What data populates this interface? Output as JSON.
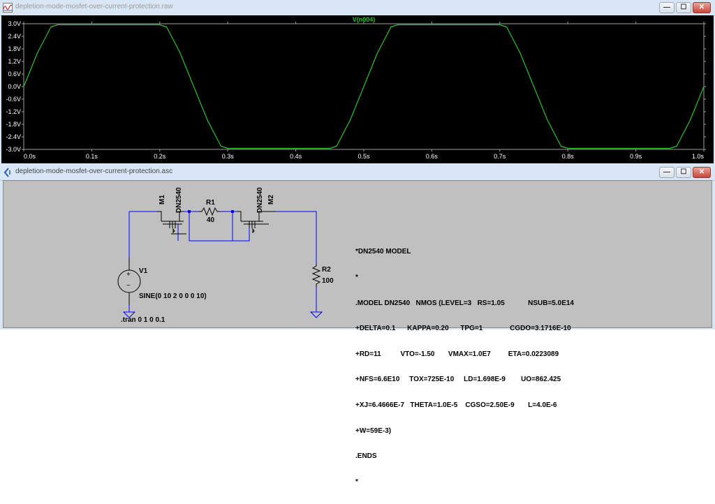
{
  "waveform_window": {
    "title": "depletion-mode-mosfet-over-current-protection.raw",
    "trace_label": "V(n004)",
    "trace_color": "#2ec02e",
    "background": "#000000",
    "axis_color": "#a0a0a0"
  },
  "schematic_window": {
    "title": "depletion-mode-mosfet-over-current-protection.asc",
    "background": "#c0c0c0",
    "wire_color": "#0000ff",
    "ground_color": "#0000ff",
    "labels": {
      "m1": "M1",
      "m1_model": "DN2540",
      "r1": "R1",
      "r1_value": "40",
      "m2": "M2",
      "m2_model": "DN2540",
      "v1": "V1",
      "v1_value": "SINE(0 10 2 0 0 0 10)",
      "r2": "R2",
      "r2_value": "100",
      "tran": ".tran 0 1 0 0.1",
      "v1_plus": "+",
      "v1_minus": "−"
    },
    "spice_model_lines": [
      "*DN2540 MODEL",
      "*",
      ".MODEL DN2540   NMOS (LEVEL=3   RS=1.05            NSUB=5.0E14",
      "+DELTA=0.1      KAPPA=0.20      TPG=1              CGDO=3.1716E-10",
      "+RD=11          VTO=-1.50       VMAX=1.0E7         ETA=0.0223089",
      "+NFS=6.6E10     TOX=725E-10     LD=1.698E-9        UO=862.425",
      "+XJ=6.4666E-7   THETA=1.0E-5    CGSO=2.50E-9       L=4.0E-6",
      "+W=59E-3)",
      ".ENDS",
      "*"
    ]
  },
  "window_buttons": {
    "minimize": "—",
    "maximize": "☐",
    "close": "✕"
  },
  "chart_data": {
    "type": "line",
    "title": "V(n004)",
    "xlabel": "",
    "ylabel": "",
    "xlim": [
      0,
      1.0
    ],
    "ylim": [
      -3.0,
      3.0
    ],
    "x_ticks": [
      "0.0s",
      "0.1s",
      "0.2s",
      "0.3s",
      "0.4s",
      "0.5s",
      "0.6s",
      "0.7s",
      "0.8s",
      "0.9s",
      "1.0s"
    ],
    "y_ticks": [
      "3.0V",
      "2.4V",
      "1.8V",
      "1.2V",
      "0.6V",
      "0.0V",
      "-0.6V",
      "-1.2V",
      "-1.8V",
      "-2.4V",
      "-3.0V"
    ],
    "grid": false,
    "series": [
      {
        "name": "V(n004)",
        "x": [
          0.0,
          0.02,
          0.04,
          0.05,
          0.2,
          0.21,
          0.23,
          0.25,
          0.27,
          0.29,
          0.3,
          0.45,
          0.46,
          0.48,
          0.5,
          0.52,
          0.54,
          0.55,
          0.7,
          0.71,
          0.73,
          0.75,
          0.77,
          0.79,
          0.8,
          0.95,
          0.96,
          0.98,
          1.0
        ],
        "y": [
          0.0,
          1.6,
          2.85,
          2.95,
          2.95,
          2.85,
          1.6,
          0.0,
          -1.6,
          -2.85,
          -2.95,
          -2.95,
          -2.85,
          -1.6,
          0.0,
          1.6,
          2.85,
          2.95,
          2.95,
          2.85,
          1.6,
          0.0,
          -1.6,
          -2.85,
          -2.95,
          -2.95,
          -2.85,
          -1.6,
          0.0
        ]
      }
    ]
  }
}
